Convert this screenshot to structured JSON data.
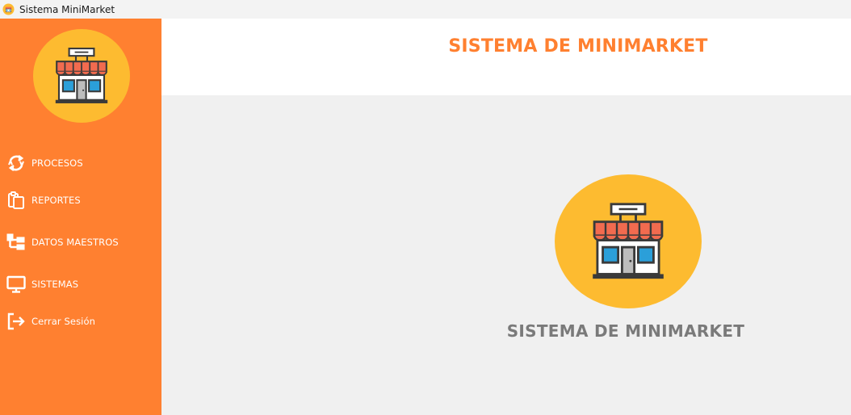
{
  "window": {
    "title": "Sistema MiniMarket",
    "icon": "store-icon"
  },
  "sidebar": {
    "logo": "store-icon",
    "items": [
      {
        "label": "PROCESOS",
        "icon": "refresh-icon"
      },
      {
        "label": "REPORTES",
        "icon": "clipboard-icon"
      },
      {
        "label": "DATOS MAESTROS",
        "icon": "hierarchy-icon"
      },
      {
        "label": "SISTEMAS",
        "icon": "monitor-icon"
      },
      {
        "label": "Cerrar Sesión",
        "icon": "logout-icon"
      }
    ]
  },
  "header": {
    "title": "SISTEMA DE MINIMARKET"
  },
  "main": {
    "logo": "store-icon",
    "title": "SISTEMA DE MINIMARKET"
  },
  "colors": {
    "sidebar": "#ff8030",
    "logo_circle": "#fdbb30",
    "header_title": "#ff8030",
    "main_title": "#7a7a7a",
    "awning": "#f26b4f",
    "window_glass": "#2b9fd9"
  }
}
